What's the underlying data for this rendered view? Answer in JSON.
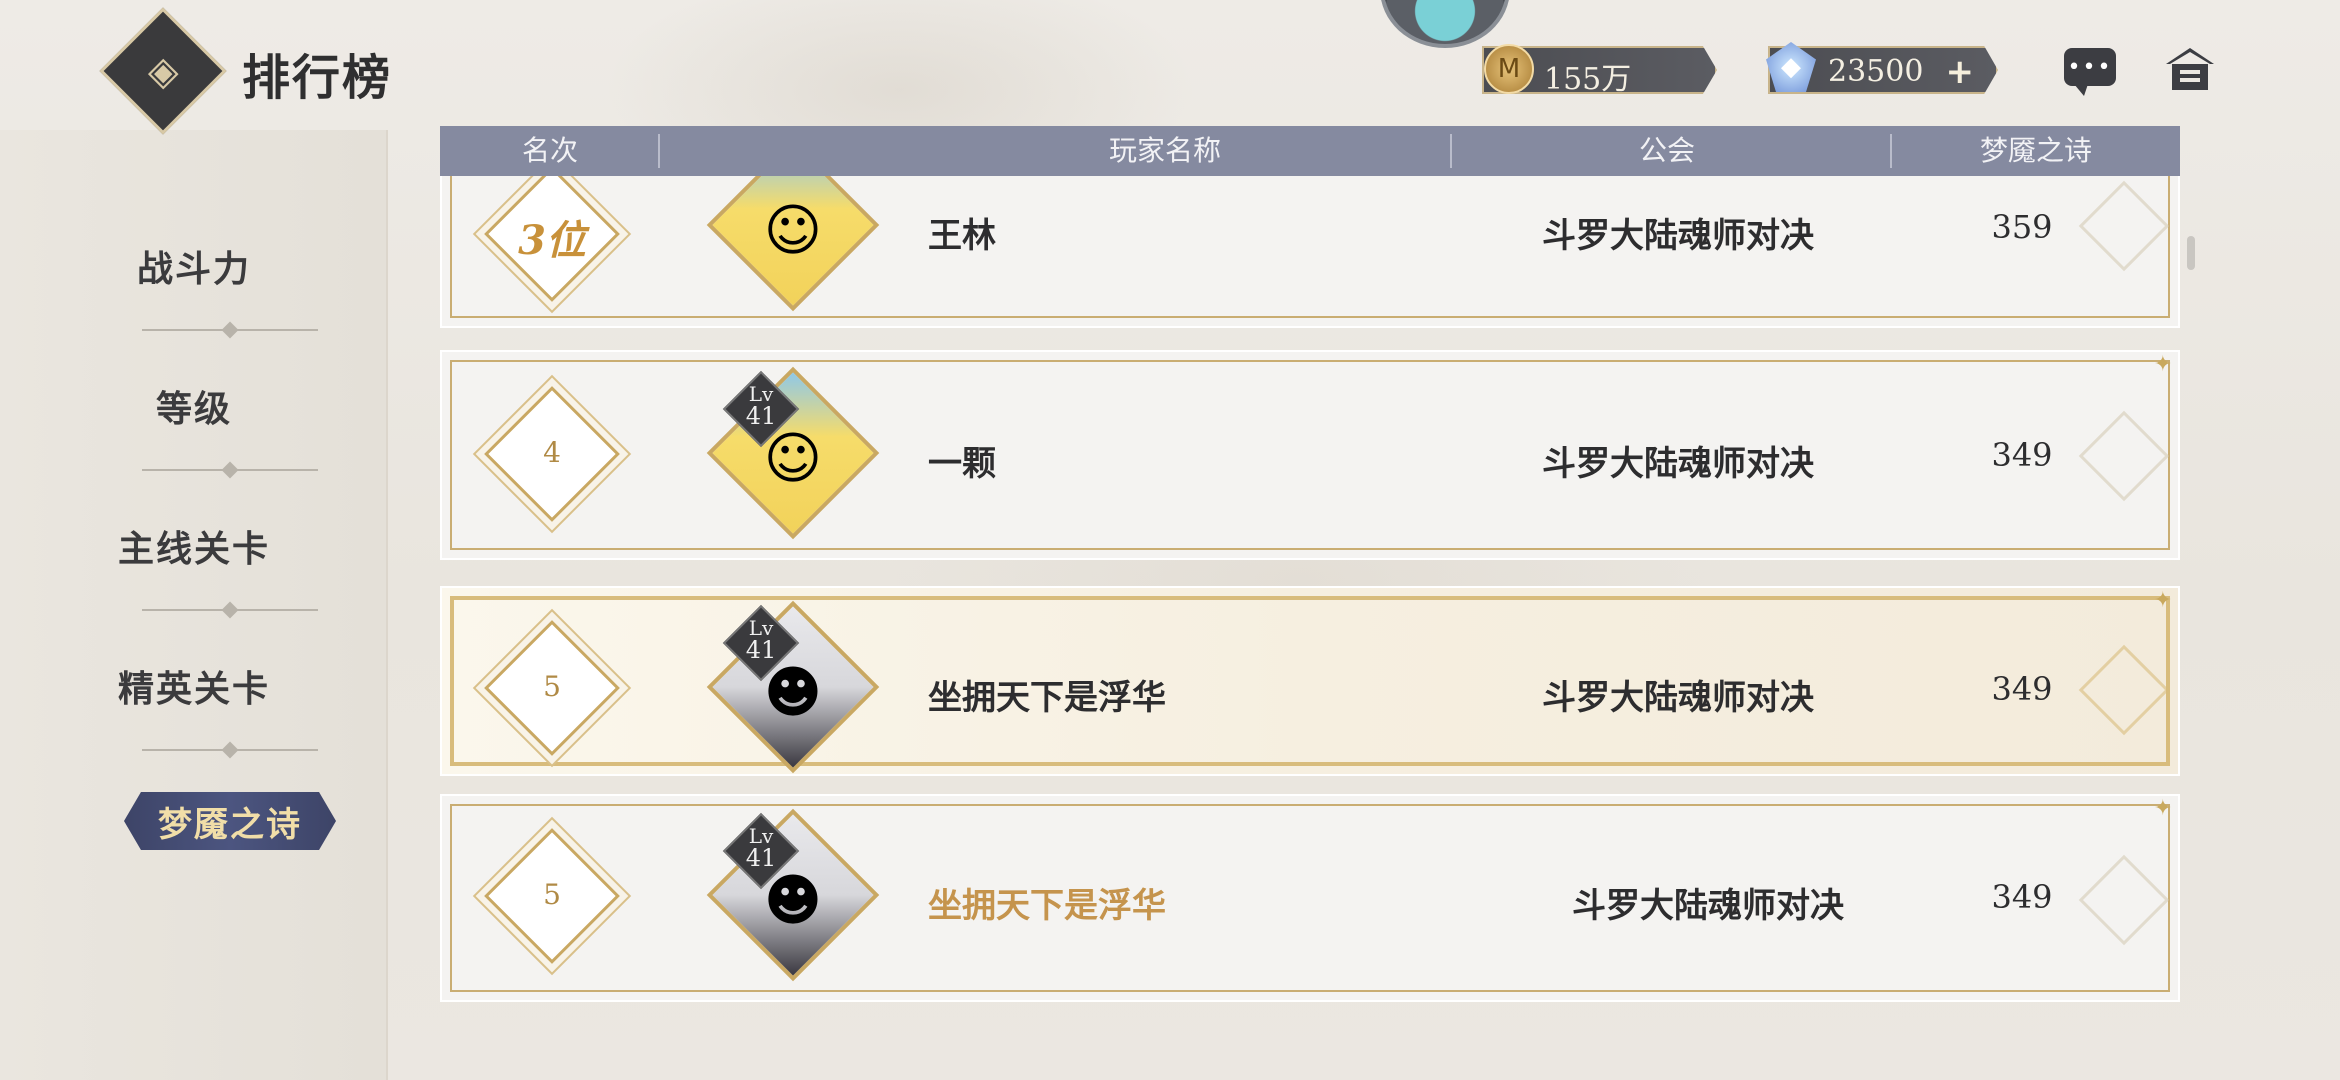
{
  "header": {
    "title": "排行榜",
    "back_icon": "back-diamond-icon",
    "gold": {
      "icon": "gold-coin-icon",
      "value": "155万"
    },
    "gems": {
      "icon": "crystal-gem-icon",
      "value": "23500",
      "add_label": "+"
    },
    "chat_icon": "chat-bubble-icon",
    "home_icon": "home-icon"
  },
  "sidebar": {
    "items": [
      {
        "label": "战斗力"
      },
      {
        "label": "等级"
      },
      {
        "label": "主线关卡"
      },
      {
        "label": "精英关卡"
      },
      {
        "label": "梦魇之诗",
        "active": true
      }
    ]
  },
  "table": {
    "columns": [
      "名次",
      "玩家名称",
      "公会",
      "梦魇之诗"
    ],
    "rows": [
      {
        "rank": "3位",
        "avatar": "yellow-pet",
        "name": "王林",
        "guild": "斗罗大陆魂师对决",
        "score": "359"
      },
      {
        "rank": "4",
        "level_label": "Lv",
        "level": "41",
        "avatar": "yellow-pet",
        "name": "一颗",
        "guild": "斗罗大陆魂师对决",
        "score": "349"
      },
      {
        "rank": "5",
        "level_label": "Lv",
        "level": "41",
        "avatar": "white-hair-hero",
        "name": "坐拥天下是浮华",
        "guild": "斗罗大陆魂师对决",
        "score": "349",
        "highlighted": true
      },
      {
        "rank": "5",
        "level_label": "Lv",
        "level": "41",
        "avatar": "white-hair-hero",
        "name": "坐拥天下是浮华",
        "guild": "斗罗大陆魂师对决",
        "score": "349",
        "self": true
      }
    ]
  },
  "colors": {
    "header_bar": "#858aa0",
    "active_tab": "#434b73",
    "gold_accent": "#c9a862",
    "self_name": "#c5944d"
  }
}
